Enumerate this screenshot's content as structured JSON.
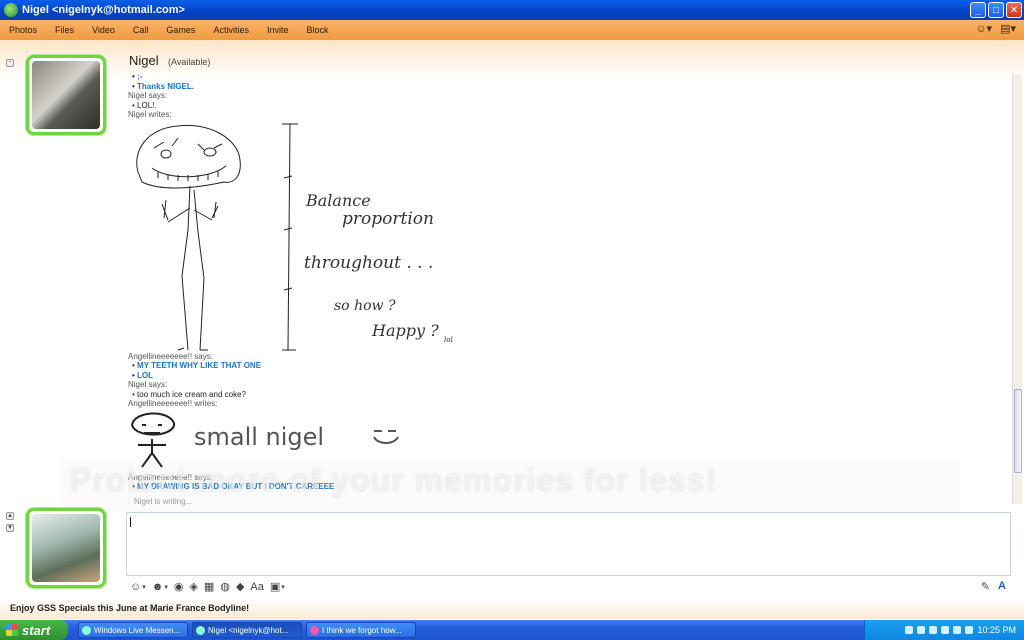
{
  "window": {
    "title": "Nigel <nigelnyk@hotmail.com>"
  },
  "menu": {
    "items": [
      "Photos",
      "Files",
      "Video",
      "Call",
      "Games",
      "Activities",
      "Invite",
      "Block"
    ]
  },
  "contact": {
    "name": "Nigel",
    "status": "(Available)"
  },
  "conversation": {
    "top_line": "Thanks NIGEL.",
    "nigel_says_1": "Nigel says:",
    "msg_lol": "LOL!.",
    "nigel_writes": "Nigel writes:",
    "ink_text_1": "Balance",
    "ink_text_2": "proportion",
    "ink_text_3": "throughout . . .",
    "ink_text_4": "so how ?",
    "ink_text_5": "Happy ?",
    "ink_text_6": "lol",
    "angel_says_1": "Angellineeeeeee!! says:",
    "msg_teeth": "MY TEETH WHY LIKE THAT ONE",
    "msg_lol2": "LOL",
    "nigel_says_2": "Nigel says:",
    "msg_icecream": "too much ice cream and coke?",
    "angel_writes": "Angellineeeeeee!! writes:",
    "ink_small": "small nigel",
    "angel_says_2": "Angellineeeeeee!! says:",
    "msg_drawing": "MY DRAWING IS BAD OKAY BUT I DON'T CAREEEE",
    "typing": "Nigel is writing...",
    "watermark": "Protect more of your memories for less!"
  },
  "ad": {
    "text": "Enjoy GSS Specials this June at Marie France Bodyline!"
  },
  "taskbar": {
    "start": "start",
    "tasks": [
      "Windows Live Messen...",
      "Nigel <nigelnyk@hot...",
      "I think we forgot how..."
    ],
    "clock": "10:25 PM"
  },
  "colors": {
    "title_bar": "#0a5ee8",
    "menu_bar": "#f09a40",
    "link_blue": "#1a75c9",
    "avatar_border": "#6cd63a"
  }
}
